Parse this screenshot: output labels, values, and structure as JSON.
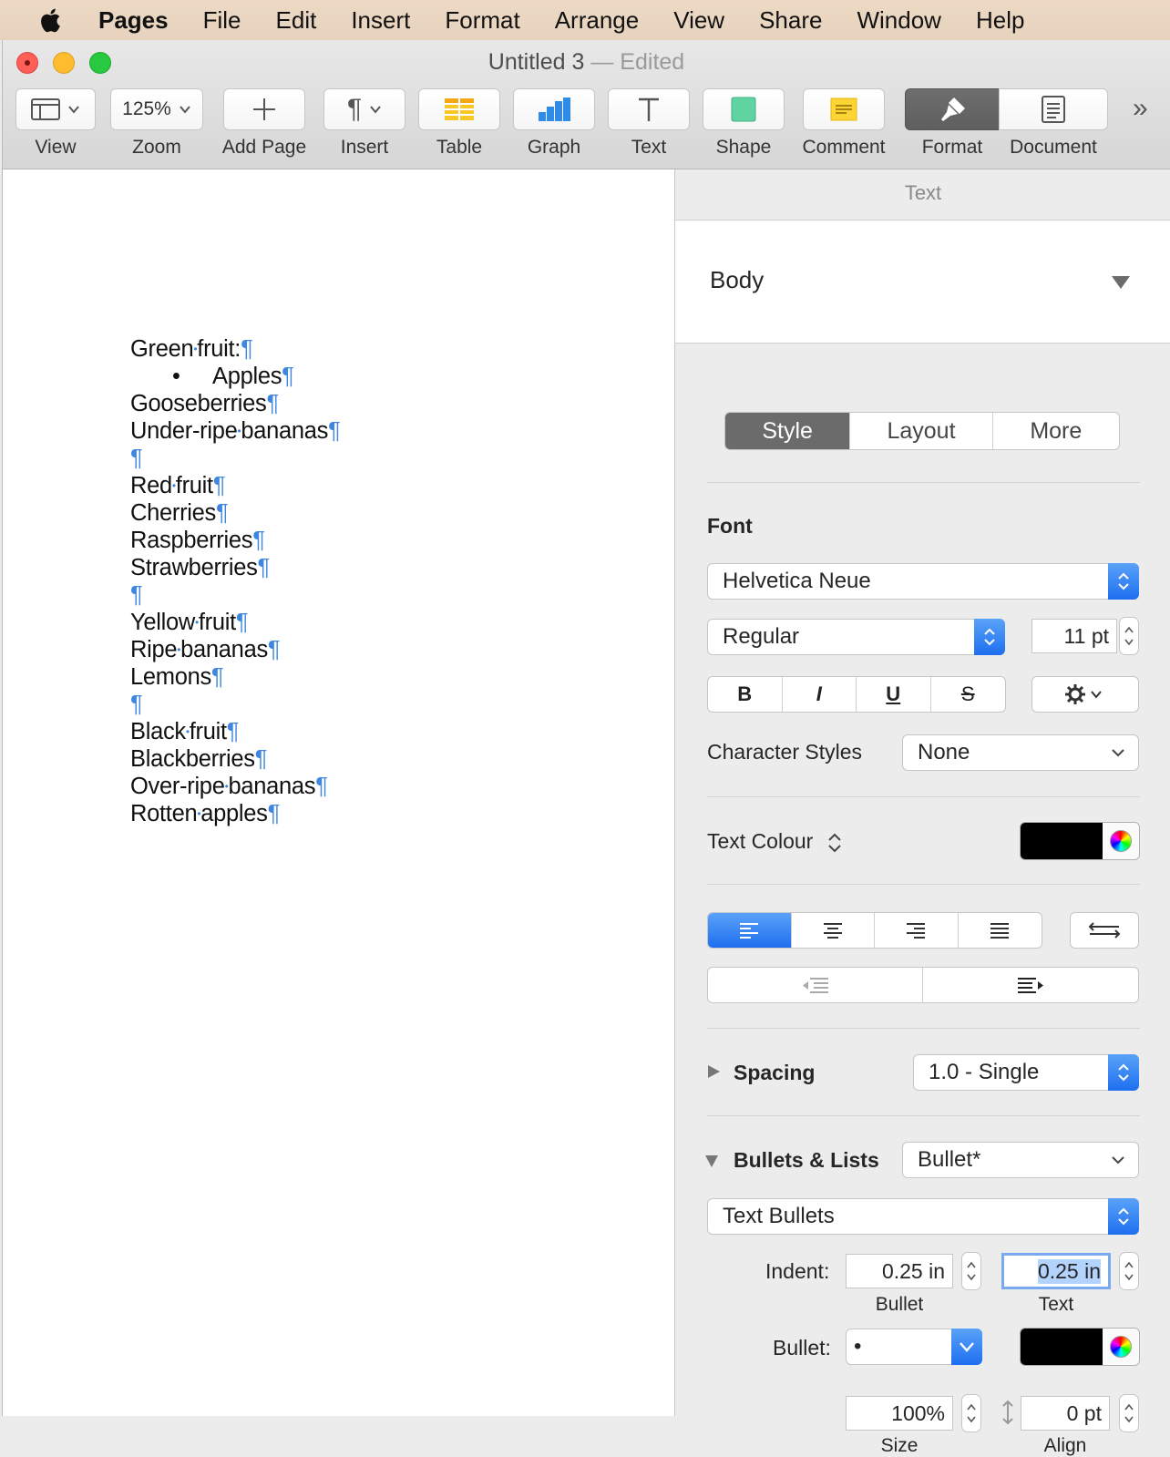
{
  "menubar": {
    "app": "Pages",
    "items": [
      "File",
      "Edit",
      "Insert",
      "Format",
      "Arrange",
      "View",
      "Share",
      "Window",
      "Help"
    ]
  },
  "window": {
    "title": "Untitled 3",
    "status": "— Edited"
  },
  "toolbar": {
    "view": "View",
    "zoom_value": "125%",
    "zoom": "Zoom",
    "add_page": "Add Page",
    "insert": "Insert",
    "table": "Table",
    "graph": "Graph",
    "text": "Text",
    "shape": "Shape",
    "comment": "Comment",
    "format": "Format",
    "document": "Document",
    "overflow": "»"
  },
  "document": {
    "lines": [
      {
        "text": "Green•fruit:",
        "indent": false,
        "bullet": false
      },
      {
        "text": "Apples",
        "indent": true,
        "bullet": true
      },
      {
        "text": "Gooseberries",
        "indent": false,
        "bullet": false
      },
      {
        "text": "Under-ripe•bananas",
        "indent": false,
        "bullet": false
      },
      {
        "text": "",
        "indent": false,
        "bullet": false
      },
      {
        "text": "Red•fruit",
        "indent": false,
        "bullet": false
      },
      {
        "text": "Cherries",
        "indent": false,
        "bullet": false
      },
      {
        "text": "Raspberries",
        "indent": false,
        "bullet": false
      },
      {
        "text": "Strawberries",
        "indent": false,
        "bullet": false
      },
      {
        "text": "",
        "indent": false,
        "bullet": false
      },
      {
        "text": "Yellow•fruit",
        "indent": false,
        "bullet": false
      },
      {
        "text": "Ripe•bananas",
        "indent": false,
        "bullet": false
      },
      {
        "text": "Lemons",
        "indent": false,
        "bullet": false
      },
      {
        "text": "",
        "indent": false,
        "bullet": false
      },
      {
        "text": "Black•fruit",
        "indent": false,
        "bullet": false
      },
      {
        "text": "Blackberries",
        "indent": false,
        "bullet": false
      },
      {
        "text": "Over-ripe•bananas",
        "indent": false,
        "bullet": false
      },
      {
        "text": "Rotten•apples",
        "indent": false,
        "bullet": false
      }
    ],
    "pilcrow": "¶",
    "bullet_char": "•"
  },
  "inspector": {
    "header": "Text",
    "paragraph_style": "Body",
    "tabs": [
      "Style",
      "Layout",
      "More"
    ],
    "font_label": "Font",
    "font_family": "Helvetica Neue",
    "font_typeface": "Regular",
    "font_size": "11 pt",
    "bold": "B",
    "italic": "I",
    "underline": "U",
    "strike": "S",
    "char_styles_label": "Character Styles",
    "char_styles_value": "None",
    "text_colour_label": "Text Colour",
    "spacing_label": "Spacing",
    "spacing_value": "1.0 - Single",
    "bullets_label": "Bullets & Lists",
    "bullets_value": "Bullet*",
    "bullet_type": "Text Bullets",
    "indent_label": "Indent:",
    "indent_bullet": "0.25 in",
    "indent_text": "0.25 in",
    "bullet_sub": "Bullet",
    "text_sub": "Text",
    "bullet_label": "Bullet:",
    "bullet_value": "•",
    "size_value": "100%",
    "align_value": "0 pt",
    "size_sub": "Size",
    "align_sub": "Align"
  },
  "colors": {
    "accent": "#1e6ff0",
    "pilcrow": "#3e86e0",
    "text_colour": "#000000"
  }
}
